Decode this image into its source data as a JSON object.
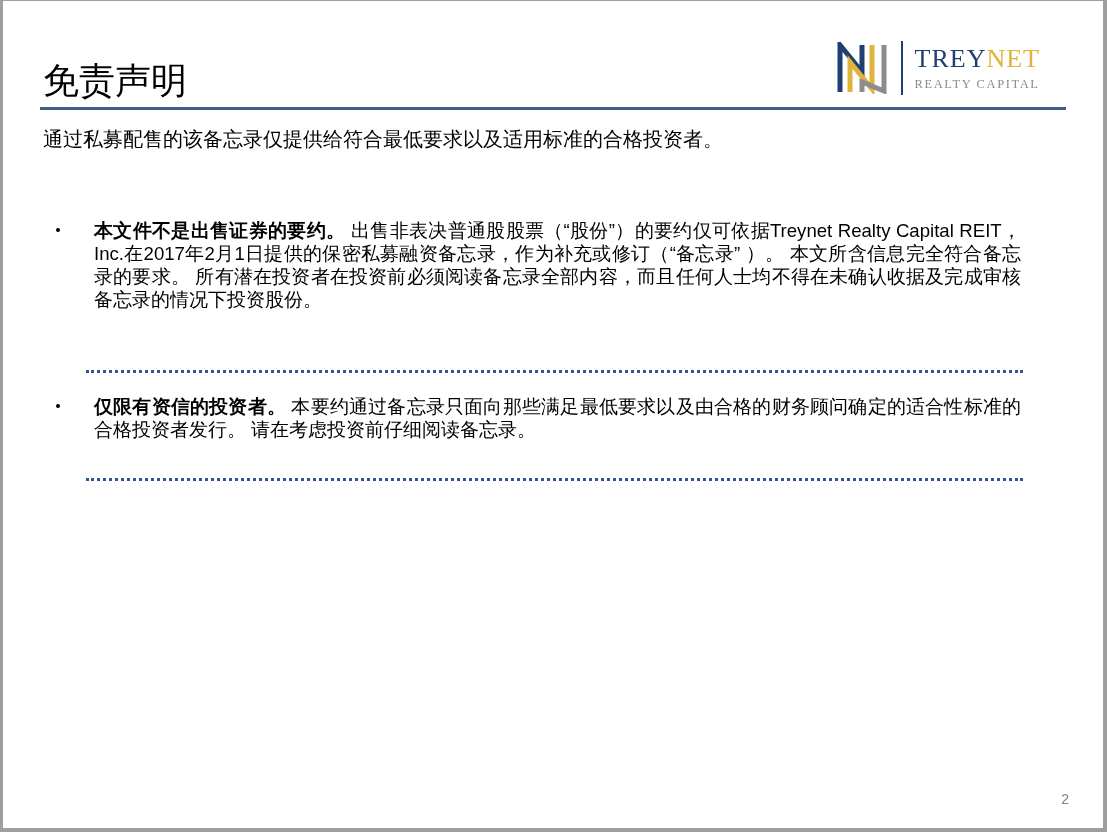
{
  "slide": {
    "title": "免责声明",
    "logo": {
      "name_parts": [
        {
          "text": "TREY",
          "color": "#1f3f73"
        },
        {
          "text": "NET",
          "color": "#e0b43a"
        }
      ],
      "tagline": "REALTY CAPITAL"
    },
    "intro": "通过私募配售的该备忘录仅提供给符合最低要求以及适用标准的合格投资者。",
    "bullets": [
      {
        "text": "**本文件不是出售证券的要约。** 出售非表决普通股股票（“股份”）的要约仅可依据Treynet Realty Capital REIT，Inc.在2017年2月1日提供的保密私募融资备忘录，作为补充或修订（“备忘录” ）。 本文所含信息完全符合备忘录的要求。 所有潜在投资者在投资前必须阅读备忘录全部内容，而且任何人士均不得在未确认收据及完成审核备忘录的情况下投资股份。"
      },
      {
        "text": "**仅限有资信的投资者。** 本要约通过备忘录只面向那些满足最低要求以及由合格的财务顾问确定的适合性标准的合格投资者发行。 请在考虑投资前仔细阅读备忘录。"
      }
    ],
    "page_number": "2"
  }
}
